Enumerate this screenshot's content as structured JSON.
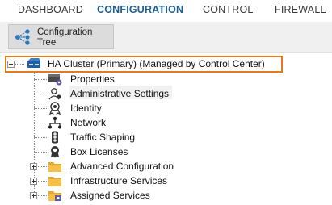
{
  "nav": {
    "tabs": [
      {
        "label": "DASHBOARD"
      },
      {
        "label": "CONFIGURATION"
      },
      {
        "label": "CONTROL"
      },
      {
        "label": "FIREWALL"
      }
    ]
  },
  "toolbar": {
    "config_tree_line1": "Configuration",
    "config_tree_line2": "Tree"
  },
  "tree": {
    "root_label": "HA Cluster (Primary) (Managed by Control Center)",
    "items": [
      {
        "label": "Properties",
        "icon": "properties-icon"
      },
      {
        "label": "Administrative Settings",
        "icon": "admin-settings-icon"
      },
      {
        "label": "Identity",
        "icon": "identity-icon"
      },
      {
        "label": "Network",
        "icon": "network-icon"
      },
      {
        "label": "Traffic Shaping",
        "icon": "traffic-light-icon"
      },
      {
        "label": "Box Licenses",
        "icon": "license-icon"
      },
      {
        "label": "Advanced Configuration",
        "icon": "folder-icon"
      },
      {
        "label": "Infrastructure Services",
        "icon": "folder-icon"
      },
      {
        "label": "Assigned Services",
        "icon": "services-icon"
      }
    ]
  },
  "colors": {
    "accent": "#1f5f8f",
    "selection_border": "#e07b20",
    "folder": "#f5c04a"
  }
}
